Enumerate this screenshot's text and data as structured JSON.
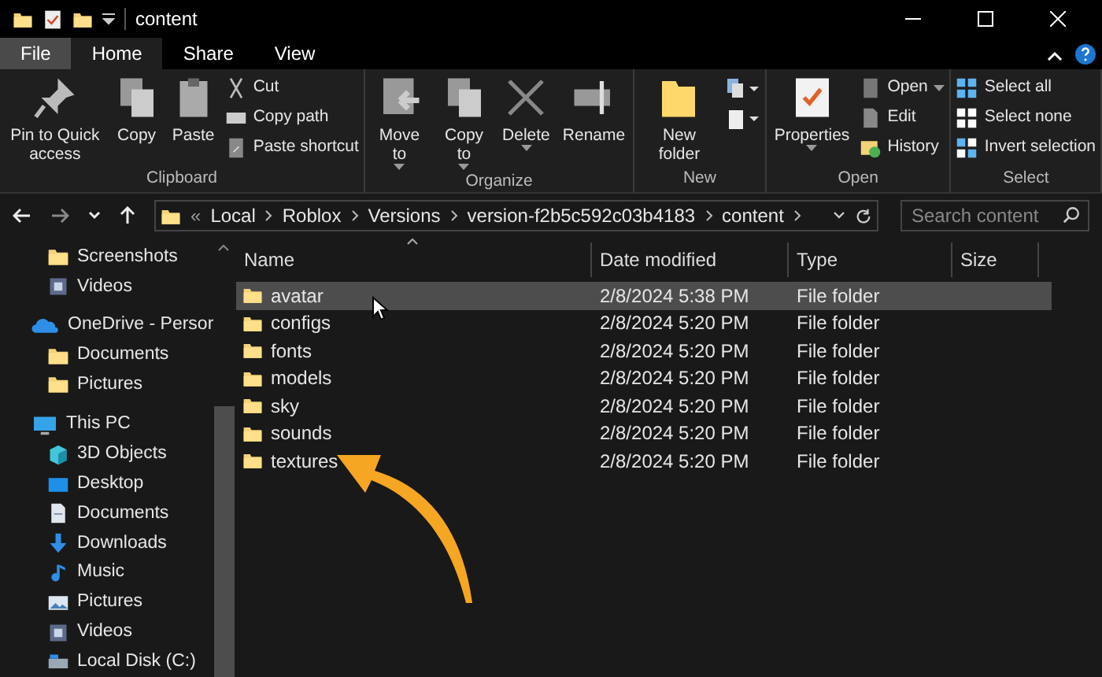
{
  "window": {
    "title": "content"
  },
  "tabs": [
    {
      "label": "File",
      "selected": false,
      "kind": "file"
    },
    {
      "label": "Home",
      "selected": true,
      "kind": "tab"
    },
    {
      "label": "Share",
      "selected": false,
      "kind": "tab"
    },
    {
      "label": "View",
      "selected": false,
      "kind": "tab"
    }
  ],
  "ribbon": [
    {
      "label": "Clipboard",
      "items": [
        {
          "label": "Pin to Quick access",
          "kind": "large"
        },
        {
          "label": "Copy",
          "kind": "large"
        },
        {
          "label": "Paste",
          "kind": "large"
        },
        {
          "label": "Cut",
          "kind": "small"
        },
        {
          "label": "Copy path",
          "kind": "small"
        },
        {
          "label": "Paste shortcut",
          "kind": "small"
        }
      ]
    },
    {
      "label": "Organize",
      "items": [
        {
          "label": "Move to",
          "kind": "large",
          "dropdown": true
        },
        {
          "label": "Copy to",
          "kind": "large",
          "dropdown": true
        },
        {
          "label": "Delete",
          "kind": "large",
          "dropdown": true
        },
        {
          "label": "Rename",
          "kind": "large",
          "dropdown": false
        }
      ]
    },
    {
      "label": "New",
      "items": [
        {
          "label": "New folder",
          "kind": "large",
          "dropdown": false
        },
        {
          "kind": "icon"
        },
        {
          "kind": "icon"
        }
      ]
    },
    {
      "label": "Open",
      "items": [
        {
          "label": "Properties",
          "kind": "large",
          "dropdown": true
        },
        {
          "label": "Open",
          "kind": "small",
          "dropdown": true
        },
        {
          "label": "Edit",
          "kind": "small"
        },
        {
          "label": "History",
          "kind": "small"
        }
      ]
    },
    {
      "label": "Select",
      "items": [
        {
          "label": "Select all",
          "kind": "small"
        },
        {
          "label": "Select none",
          "kind": "small"
        },
        {
          "label": "Invert selection",
          "kind": "small"
        }
      ]
    }
  ],
  "breadcrumbs": [
    "Local",
    "Roblox",
    "Versions",
    "version-f2b5c592c03b4183",
    "content"
  ],
  "breadcrumb_overflow": "«",
  "search": {
    "placeholder": "Search content"
  },
  "sidebar": {
    "items": [
      {
        "label": "Screenshots"
      },
      {
        "label": "Videos"
      },
      {
        "label": "OneDrive - Persor",
        "children": [
          {
            "label": "Documents"
          },
          {
            "label": "Pictures"
          }
        ]
      },
      {
        "label": "This PC",
        "children": [
          {
            "label": "3D Objects"
          },
          {
            "label": "Desktop"
          },
          {
            "label": "Documents"
          },
          {
            "label": "Downloads"
          },
          {
            "label": "Music"
          },
          {
            "label": "Pictures"
          },
          {
            "label": "Videos"
          },
          {
            "label": "Local Disk (C:)"
          }
        ]
      }
    ]
  },
  "table": {
    "columns": [
      "Name",
      "Date modified",
      "Type",
      "Size"
    ],
    "rows": [
      {
        "name": "avatar",
        "date": "2/8/2024 5:38 PM",
        "type": "File folder",
        "selected": true
      },
      {
        "name": "configs",
        "date": "2/8/2024 5:20 PM",
        "type": "File folder",
        "selected": false
      },
      {
        "name": "fonts",
        "date": "2/8/2024 5:20 PM",
        "type": "File folder",
        "selected": false
      },
      {
        "name": "models",
        "date": "2/8/2024 5:20 PM",
        "type": "File folder",
        "selected": false
      },
      {
        "name": "sky",
        "date": "2/8/2024 5:20 PM",
        "type": "File folder",
        "selected": false
      },
      {
        "name": "sounds",
        "date": "2/8/2024 5:20 PM",
        "type": "File folder",
        "selected": false
      },
      {
        "name": "textures",
        "date": "2/8/2024 5:20 PM",
        "type": "File folder",
        "selected": false
      }
    ]
  }
}
